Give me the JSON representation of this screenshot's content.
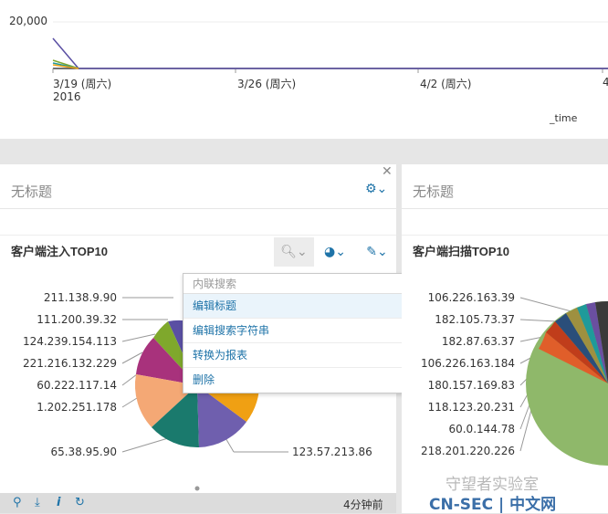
{
  "top_chart": {
    "y_tick": "20,000",
    "x_ticks": [
      {
        "label": "3/19 (周六)",
        "sublabel": "2016"
      },
      {
        "label": "3/26 (周六)",
        "sublabel": ""
      },
      {
        "label": "4/2 (周六)",
        "sublabel": ""
      },
      {
        "label": "4",
        "sublabel": ""
      }
    ],
    "x_label": "_time"
  },
  "left_panel": {
    "title": "无标题",
    "chart_title": "客户端注入TOP10",
    "footer_time": "4分钟前"
  },
  "right_panel": {
    "title": "无标题",
    "chart_title": "客户端扫描TOP10"
  },
  "dropdown": {
    "header": "内联搜索",
    "items": [
      "编辑标题",
      "编辑搜索字符串",
      "转换为报表",
      "删除"
    ]
  },
  "watermark": {
    "name": "守望者实验室",
    "site": "CN-SEC | 中文网"
  },
  "chart_data": [
    {
      "type": "pie",
      "title": "客户端注入TOP10",
      "categories": [
        "211.138.9.90",
        "111.200.39.32",
        "124.239.154.113",
        "221.216.132.229",
        "60.222.117.14",
        "1.202.251.178",
        "65.38.95.90",
        "123.57.213.86"
      ],
      "colors": [
        "#5a4fa3",
        "#7fa82c",
        "#a8327c",
        "#f4a875",
        "#f0a013",
        "#1a7a6d",
        "#6f5fae"
      ]
    },
    {
      "type": "pie",
      "title": "客户端扫描TOP10",
      "categories": [
        "106.226.163.39",
        "182.105.73.37",
        "182.87.63.37",
        "106.226.163.184",
        "180.157.169.83",
        "118.123.20.231",
        "60.0.144.78",
        "218.201.220.226"
      ],
      "colors": [
        "#8fb86a",
        "#e05e2a",
        "#c03d1b",
        "#2a4e7a",
        "#9e9040",
        "#1f9a9a",
        "#6a4fa0",
        "#3a3a3a"
      ]
    }
  ]
}
